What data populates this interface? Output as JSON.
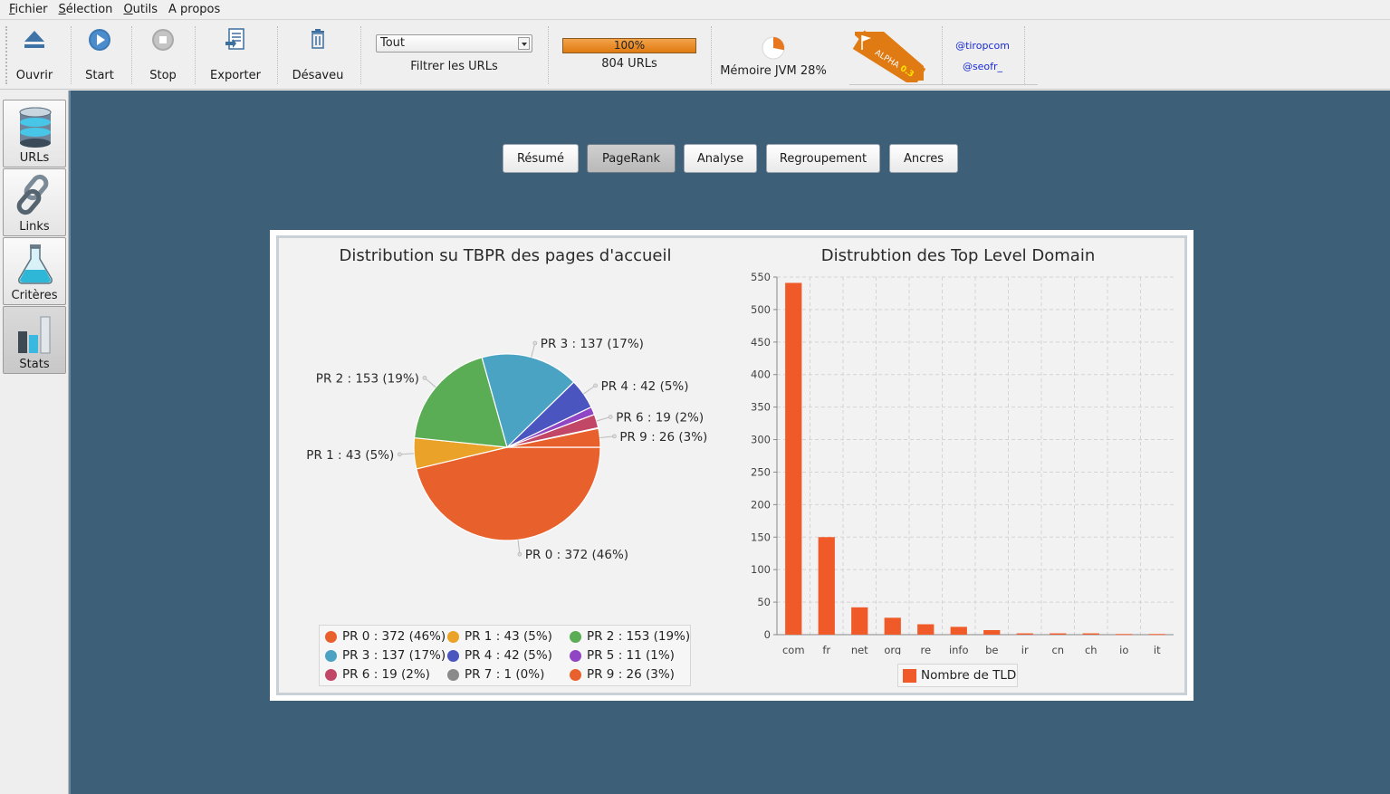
{
  "menu": [
    {
      "u": "F",
      "rest": "ichier"
    },
    {
      "u": "S",
      "rest": "élection"
    },
    {
      "u": "O",
      "rest": "utils"
    },
    {
      "u": "",
      "rest": "A propos"
    }
  ],
  "toolbar": {
    "open_label": "Ouvrir",
    "start_label": "Start",
    "stop_label": "Stop",
    "export_label": "Exporter",
    "disavow_label": "Désaveu",
    "filter_value": "Tout",
    "filter_label": "Filtrer les URLs",
    "progress_text": "100%",
    "progress_value": 1.0,
    "urls_count": "804 URLs",
    "memory_label": "Mémoire JVM 28%",
    "memory_value": 0.28,
    "alpha_text": "ALPHA",
    "alpha_version": "0.3",
    "twitter_1": "@tiropcom",
    "twitter_2": "@seofr_"
  },
  "sidebar": {
    "items": [
      {
        "label": "URLs",
        "icon": "database-icon"
      },
      {
        "label": "Links",
        "icon": "chain-link-icon"
      },
      {
        "label": "Critères",
        "icon": "flask-icon"
      },
      {
        "label": "Stats",
        "icon": "bar-chart-icon"
      }
    ]
  },
  "tabs": [
    {
      "label": "Résumé",
      "selected": false
    },
    {
      "label": "PageRank",
      "selected": true
    },
    {
      "label": "Analyse",
      "selected": false
    },
    {
      "label": "Regroupement",
      "selected": false
    },
    {
      "label": "Ancres",
      "selected": false
    }
  ],
  "chart_data": [
    {
      "type": "pie",
      "title": "Distribution su TBPR des pages d'accueil",
      "slices": [
        {
          "name": "PR 0",
          "value": 372,
          "label": "PR 0 : 372 (46%)",
          "color": "#e8612d"
        },
        {
          "name": "PR 1",
          "value": 43,
          "label": "PR 1 : 43 (5%)",
          "color": "#eaa228"
        },
        {
          "name": "PR 2",
          "value": 153,
          "label": "PR 2 : 153 (19%)",
          "color": "#5aad55"
        },
        {
          "name": "PR 3",
          "value": 137,
          "label": "PR 3 : 137 (17%)",
          "color": "#4aa3c3"
        },
        {
          "name": "PR 4",
          "value": 42,
          "label": "PR 4 : 42 (5%)",
          "color": "#4a55c0"
        },
        {
          "name": "PR 5",
          "value": 11,
          "label": "PR 5 : 11 (1%)",
          "color": "#8f45c4"
        },
        {
          "name": "PR 6",
          "value": 19,
          "label": "PR 6 : 19 (2%)",
          "color": "#c24766"
        },
        {
          "name": "PR 7",
          "value": 1,
          "label": "PR 7 : 1 (0%)",
          "color": "#8a8a8a"
        },
        {
          "name": "PR 9",
          "value": 26,
          "label": "PR 9 : 26 (3%)",
          "color": "#e8612d"
        }
      ],
      "callouts": [
        "PR 0 : 372 (46%)",
        "PR 1 : 43 (5%)",
        "PR 2 : 153 (19%)",
        "PR 3 : 137 (17%)",
        "PR 4 : 42 (5%)",
        "PR 6 : 19 (2%)",
        "PR 9 : 26 (3%)"
      ],
      "legend": "bottom"
    },
    {
      "type": "bar",
      "title": "Distrubtion des Top Level Domain",
      "categories": [
        "com",
        "fr",
        "net",
        "org",
        "re",
        "info",
        "be",
        "ir",
        "cn",
        "ch",
        "io",
        "it"
      ],
      "series": [
        {
          "name": "Nombre de TLD",
          "values": [
            541,
            150,
            42,
            26,
            16,
            12,
            7,
            2,
            2,
            2,
            1,
            1
          ],
          "color": "#f05a28"
        }
      ],
      "ylim": [
        0,
        550
      ],
      "yticks": [
        0,
        50,
        100,
        150,
        200,
        250,
        300,
        350,
        400,
        450,
        500,
        550
      ],
      "grid": true,
      "legend": "bottom"
    }
  ]
}
